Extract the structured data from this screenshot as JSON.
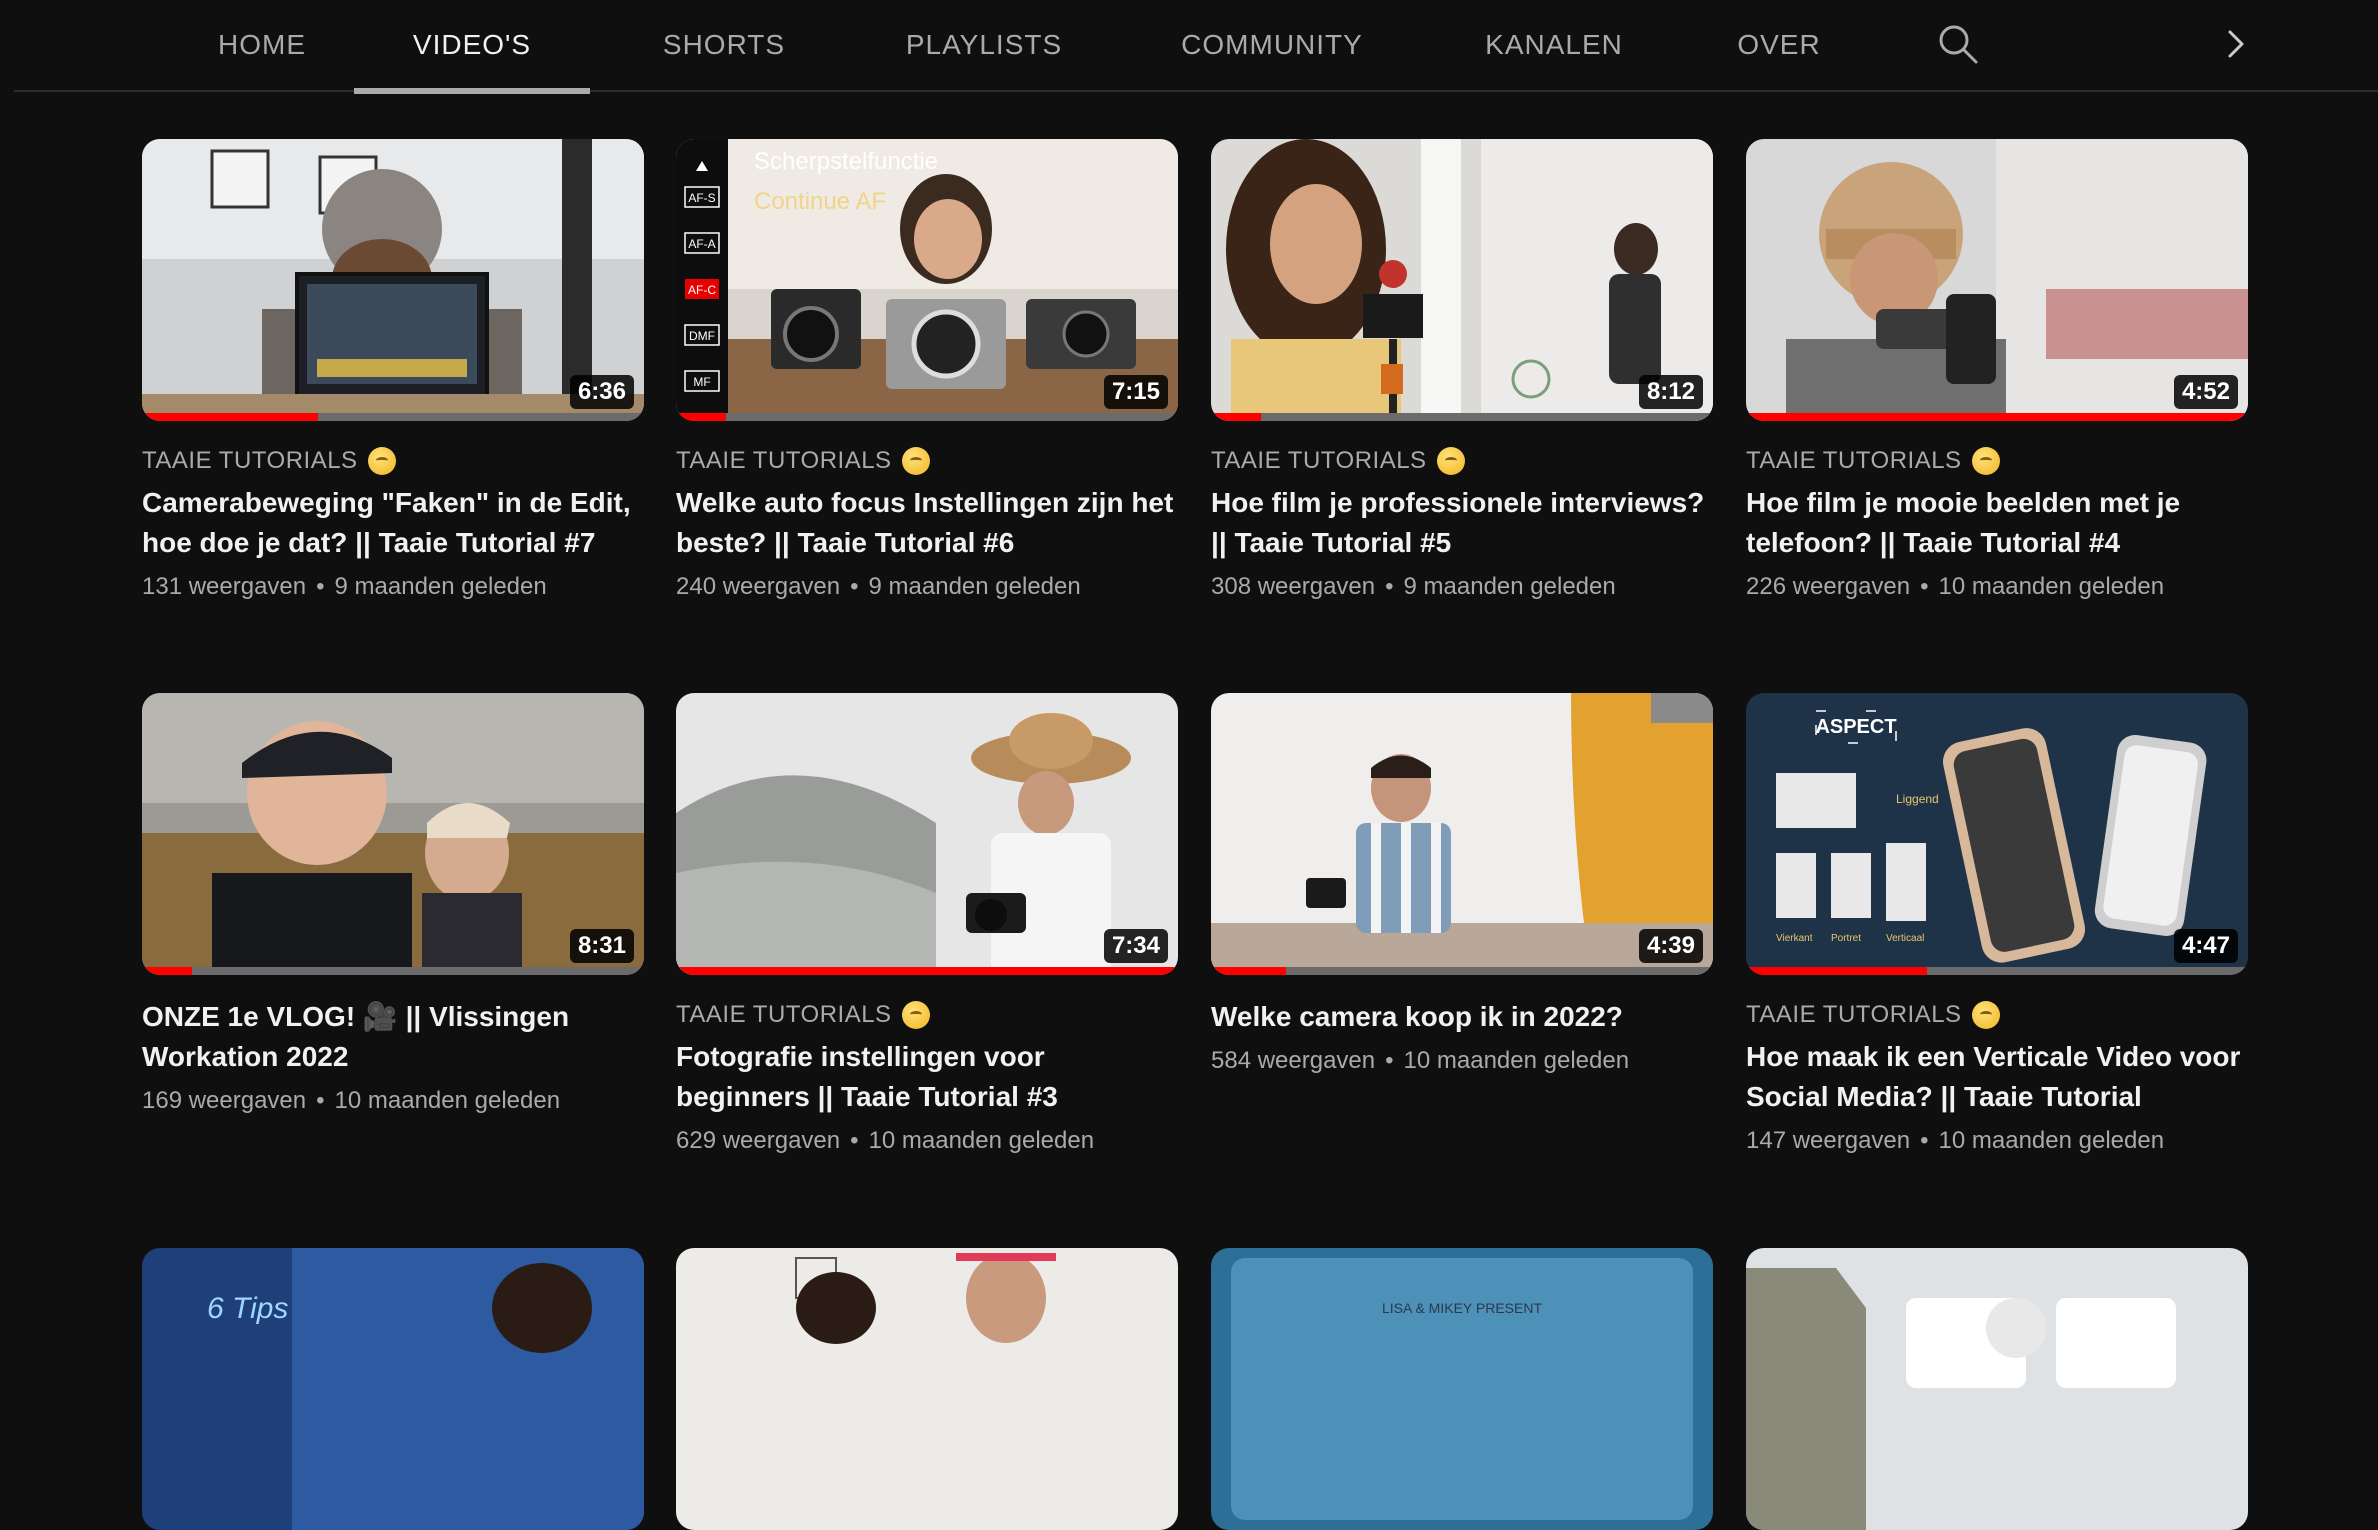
{
  "tabs": [
    {
      "label": "HOME",
      "active": false
    },
    {
      "label": "VIDEO'S",
      "active": true
    },
    {
      "label": "SHORTS",
      "active": false
    },
    {
      "label": "PLAYLISTS",
      "active": false
    },
    {
      "label": "COMMUNITY",
      "active": false
    },
    {
      "label": "KANALEN",
      "active": false
    },
    {
      "label": "OVER",
      "active": false
    }
  ],
  "icons": {
    "search": "search-icon",
    "next": "chevron-right-icon"
  },
  "colors": {
    "background": "#0f0f0f",
    "progress": "#ff0000",
    "tab_indicator": "#aaaaaa"
  },
  "videos": [
    {
      "channel": "TAAIE TUTORIALS",
      "title": "Camerabeweging \"Faken\" in de Edit, hoe doe je dat? || Taaie Tutorial #7",
      "views": "131 weergaven",
      "age": "9 maanden geleden",
      "duration": "6:36",
      "progress": 0.35
    },
    {
      "channel": "TAAIE TUTORIALS",
      "title": "Welke auto focus Instellingen zijn het beste? || Taaie Tutorial #6",
      "views": "240 weergaven",
      "age": "9 maanden geleden",
      "duration": "7:15",
      "progress": 0.1,
      "thumb_text": [
        "Scherpstelfunctie",
        "Continue AF"
      ],
      "thumb_menu": [
        "AF-S",
        "AF-A",
        "AF-C",
        "DMF",
        "MF"
      ]
    },
    {
      "channel": "TAAIE TUTORIALS",
      "title": "Hoe film je professionele interviews? || Taaie Tutorial #5",
      "views": "308 weergaven",
      "age": "9 maanden geleden",
      "duration": "8:12",
      "progress": 0.1
    },
    {
      "channel": "TAAIE TUTORIALS",
      "title": "Hoe film je mooie beelden met je telefoon? || Taaie Tutorial #4",
      "views": "226 weergaven",
      "age": "10 maanden geleden",
      "duration": "4:52",
      "progress": 1.0
    },
    {
      "channel": "",
      "title": "ONZE 1e VLOG! 🎥 || Vlissingen Workation 2022",
      "views": "169 weergaven",
      "age": "10 maanden geleden",
      "duration": "8:31",
      "progress": 0.1
    },
    {
      "channel": "TAAIE TUTORIALS",
      "title": "Fotografie instellingen voor beginners || Taaie Tutorial #3",
      "views": "629 weergaven",
      "age": "10 maanden geleden",
      "duration": "7:34",
      "progress": 1.0
    },
    {
      "channel": "",
      "title": "Welke camera koop ik in 2022?",
      "views": "584 weergaven",
      "age": "10 maanden geleden",
      "duration": "4:39",
      "progress": 0.15
    },
    {
      "channel": "TAAIE TUTORIALS",
      "title": "Hoe maak ik een Verticale Video voor Social Media? || Taaie Tutorial",
      "views": "147 weergaven",
      "age": "10 maanden geleden",
      "duration": "4:47",
      "progress": 0.36,
      "thumb_text": [
        "ASPECT",
        "Liggend",
        "Vierkant",
        "Portret",
        "Verticaal"
      ]
    }
  ],
  "partial_thumbs": [
    {
      "text": "6 Tips"
    },
    {
      "text": ""
    },
    {
      "text": "LISA & MIKEY PRESENT"
    },
    {
      "text": ""
    }
  ]
}
